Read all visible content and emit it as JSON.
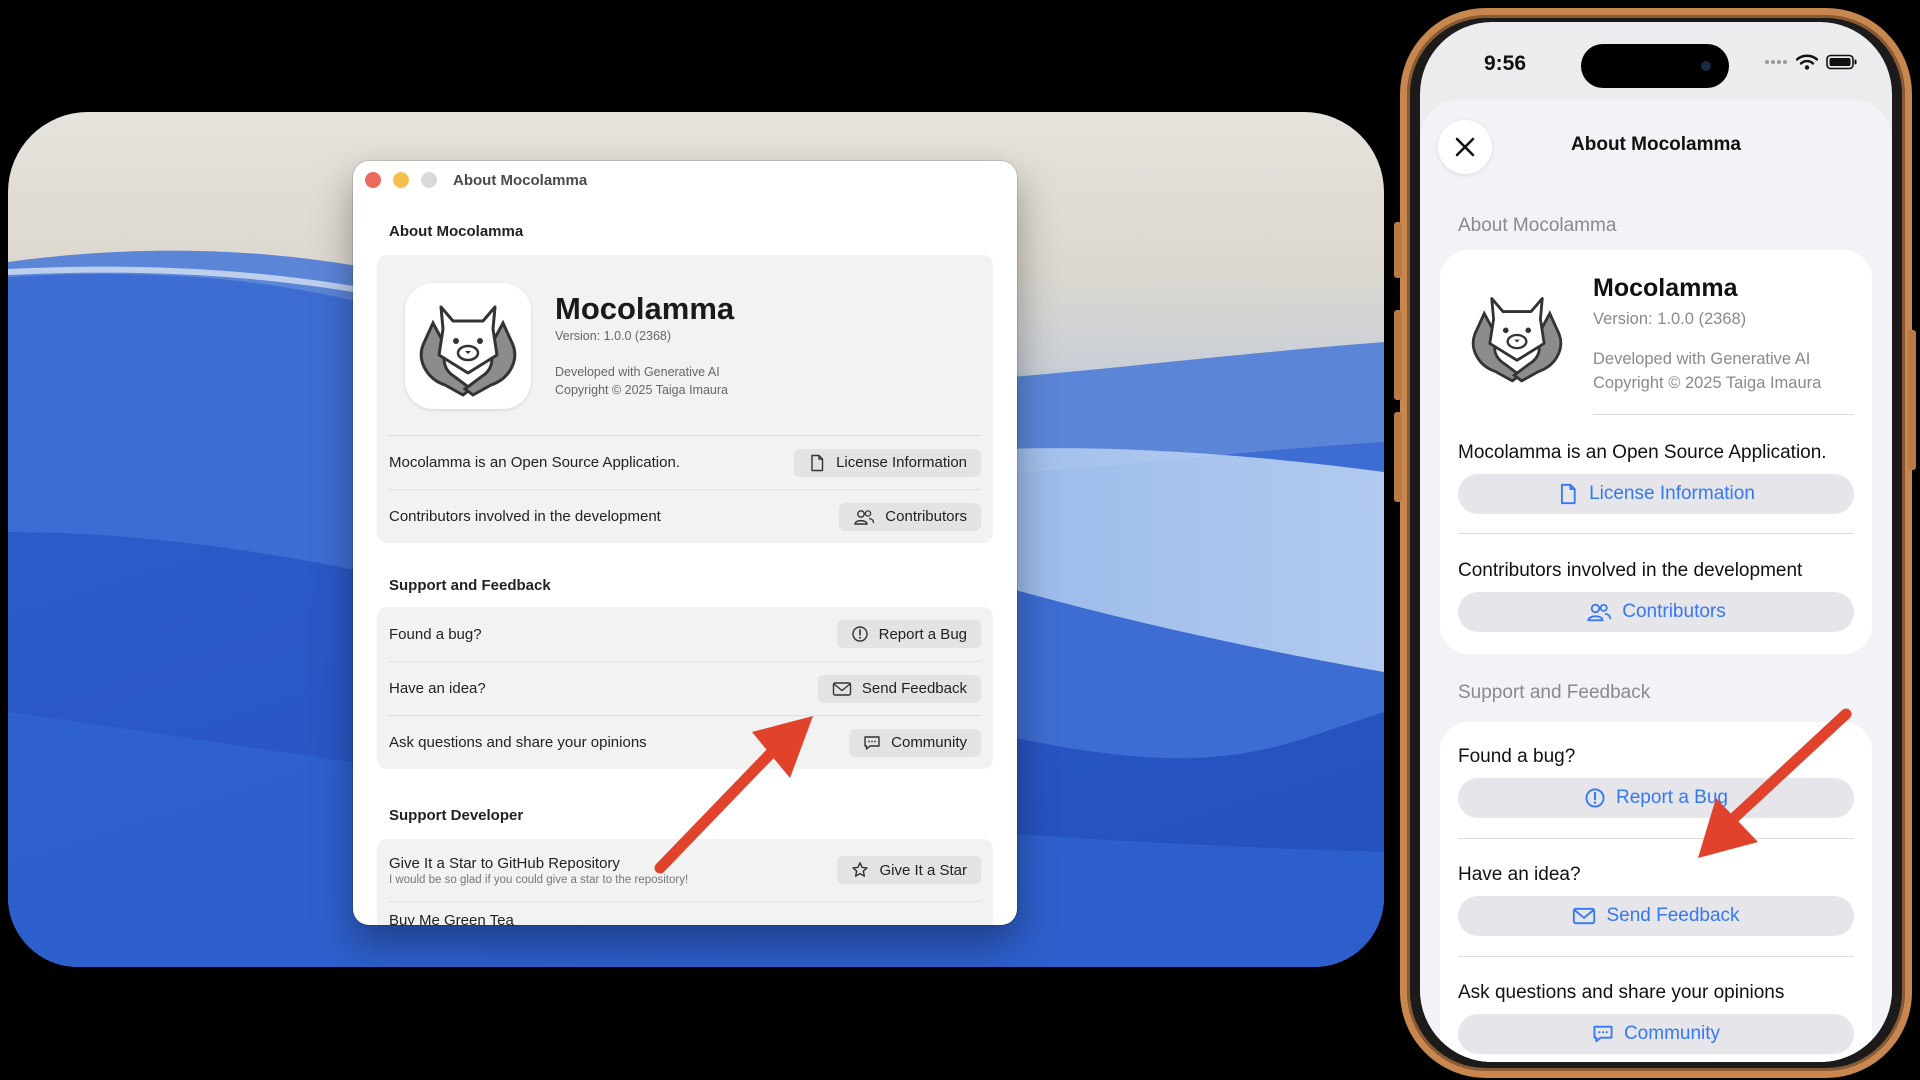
{
  "mac": {
    "window_title": "About Mocolamma",
    "about_header": "About Mocolamma",
    "app_name": "Mocolamma",
    "version": "Version: 1.0.0 (2368)",
    "developed": "Developed with Generative AI",
    "copyright": "Copyright © 2025 Taiga Imaura",
    "about_rows": [
      {
        "label": "Mocolamma is an Open Source Application.",
        "button": "License Information",
        "icon": "document-icon"
      },
      {
        "label": "Contributors involved in the development",
        "button": "Contributors",
        "icon": "people-icon"
      }
    ],
    "support_header": "Support and Feedback",
    "support_rows": [
      {
        "label": "Found a bug?",
        "button": "Report a Bug",
        "icon": "exclamation-circle-icon"
      },
      {
        "label": "Have an idea?",
        "button": "Send Feedback",
        "icon": "envelope-icon"
      },
      {
        "label": "Ask questions and share your opinions",
        "button": "Community",
        "icon": "chat-bubble-icon"
      }
    ],
    "developer_header": "Support Developer",
    "developer_rows": [
      {
        "label": "Give It a Star to GitHub Repository",
        "sublabel": "I would be so glad if you could give a star to the repository!",
        "button": "Give It a Star",
        "icon": "star-icon"
      },
      {
        "label": "Buy Me Green Tea"
      }
    ]
  },
  "phone": {
    "time": "9:56",
    "title": "About Mocolamma",
    "about_header": "About Mocolamma",
    "app_name": "Mocolamma",
    "version": "Version: 1.0.0 (2368)",
    "developed": "Developed with Generative AI",
    "copyright": "Copyright © 2025 Taiga Imaura",
    "open_source_label": "Mocolamma is an Open Source Application.",
    "license_button": "License Information",
    "contributors_label": "Contributors involved in the development",
    "contributors_button": "Contributors",
    "support_header": "Support and Feedback",
    "bug_label": "Found a bug?",
    "bug_button": "Report a Bug",
    "idea_label": "Have an idea?",
    "feedback_button": "Send Feedback",
    "community_label": "Ask questions and share your opinions",
    "community_button": "Community"
  },
  "colors": {
    "accent_blue": "#3478f6",
    "arrow_red": "#e0422b",
    "phone_frame": "#c8874f"
  }
}
